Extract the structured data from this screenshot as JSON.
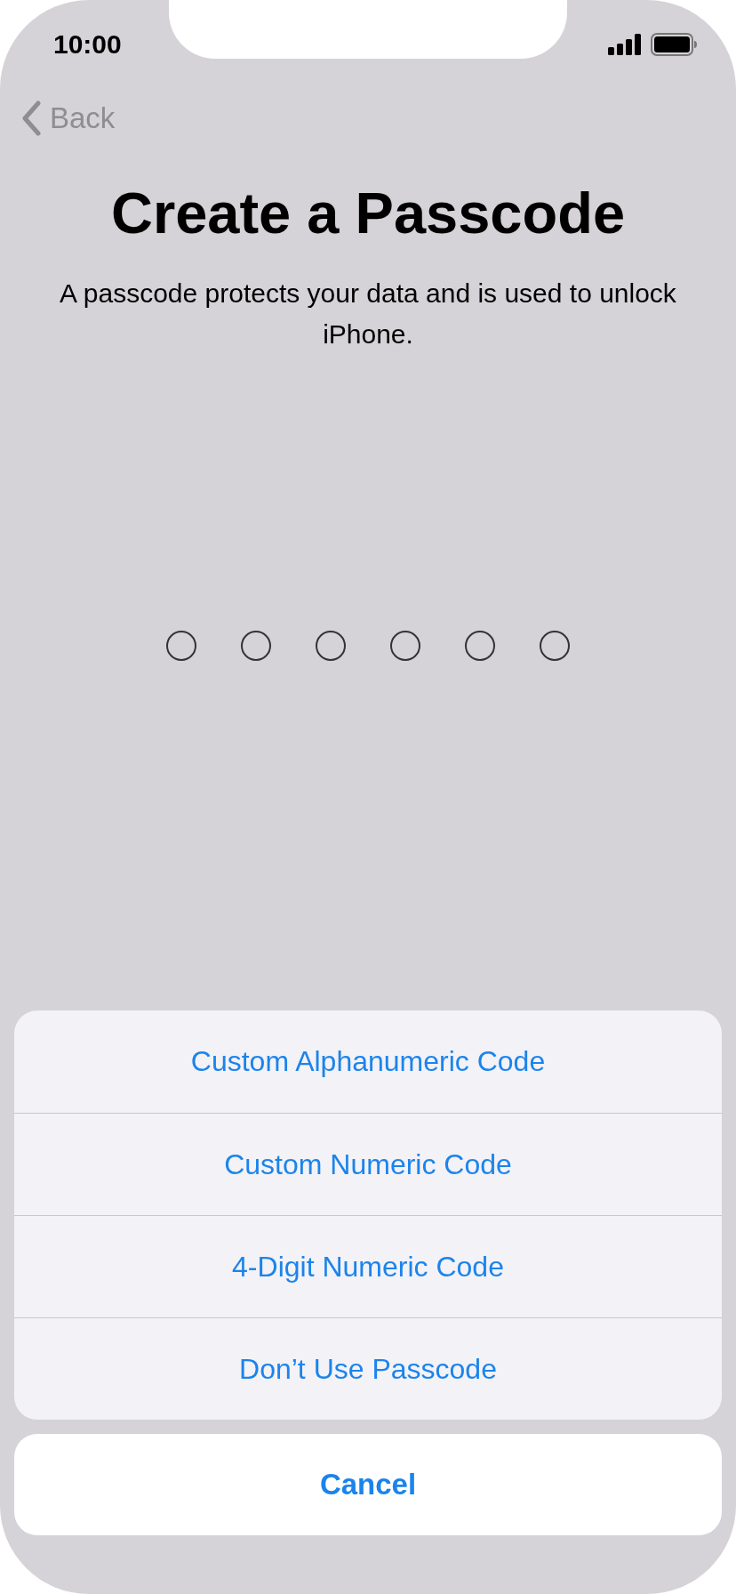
{
  "status_bar": {
    "time": "10:00"
  },
  "nav": {
    "back": "Back"
  },
  "title": "Create a Passcode",
  "subtitle": "A passcode protects your data and is used to unlock iPhone.",
  "passcode_dots": [
    {
      "filled": false
    },
    {
      "filled": false
    },
    {
      "filled": false
    },
    {
      "filled": false
    },
    {
      "filled": false
    },
    {
      "filled": false
    }
  ],
  "action_sheet": {
    "options": [
      "Custom Alphanumeric Code",
      "Custom Numeric Code",
      "4-Digit Numeric Code",
      "Don’t Use Passcode"
    ],
    "cancel": "Cancel"
  }
}
